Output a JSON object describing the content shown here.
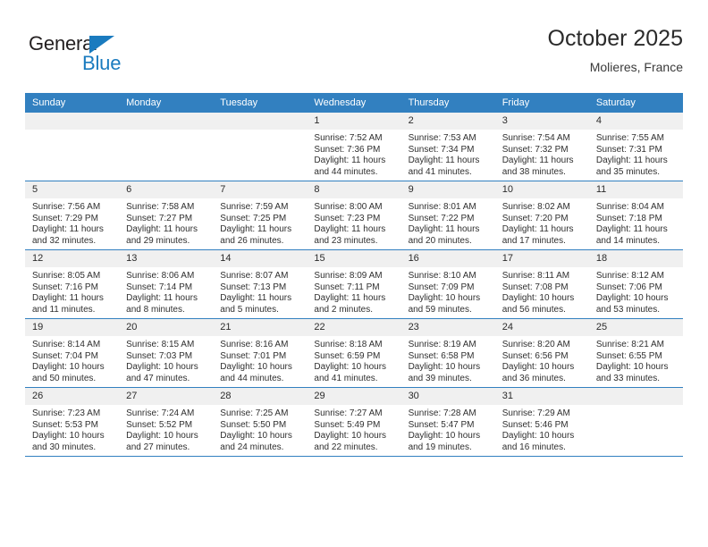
{
  "brand": {
    "name_part1": "General",
    "name_part2": "Blue",
    "triangle_icon": "triangle-icon",
    "color_primary": "#1a7bbf",
    "color_dark": "#231f20"
  },
  "header": {
    "title": "October 2025",
    "subtitle": "Molieres, France"
  },
  "theme": {
    "header_row_bg": "#3280c0",
    "daynum_bg": "#f0f0f0",
    "text": "#2f2f2f"
  },
  "weekdays": [
    "Sunday",
    "Monday",
    "Tuesday",
    "Wednesday",
    "Thursday",
    "Friday",
    "Saturday"
  ],
  "labels": {
    "sunrise": "Sunrise:",
    "sunset": "Sunset:",
    "daylight": "Daylight:"
  },
  "weeks": [
    [
      {
        "day": "",
        "sunrise": "",
        "sunset": "",
        "daylight": "",
        "empty": true
      },
      {
        "day": "",
        "sunrise": "",
        "sunset": "",
        "daylight": "",
        "empty": true
      },
      {
        "day": "",
        "sunrise": "",
        "sunset": "",
        "daylight": "",
        "empty": true
      },
      {
        "day": "1",
        "sunrise": "Sunrise: 7:52 AM",
        "sunset": "Sunset: 7:36 PM",
        "daylight": "Daylight: 11 hours and 44 minutes."
      },
      {
        "day": "2",
        "sunrise": "Sunrise: 7:53 AM",
        "sunset": "Sunset: 7:34 PM",
        "daylight": "Daylight: 11 hours and 41 minutes."
      },
      {
        "day": "3",
        "sunrise": "Sunrise: 7:54 AM",
        "sunset": "Sunset: 7:32 PM",
        "daylight": "Daylight: 11 hours and 38 minutes."
      },
      {
        "day": "4",
        "sunrise": "Sunrise: 7:55 AM",
        "sunset": "Sunset: 7:31 PM",
        "daylight": "Daylight: 11 hours and 35 minutes."
      }
    ],
    [
      {
        "day": "5",
        "sunrise": "Sunrise: 7:56 AM",
        "sunset": "Sunset: 7:29 PM",
        "daylight": "Daylight: 11 hours and 32 minutes."
      },
      {
        "day": "6",
        "sunrise": "Sunrise: 7:58 AM",
        "sunset": "Sunset: 7:27 PM",
        "daylight": "Daylight: 11 hours and 29 minutes."
      },
      {
        "day": "7",
        "sunrise": "Sunrise: 7:59 AM",
        "sunset": "Sunset: 7:25 PM",
        "daylight": "Daylight: 11 hours and 26 minutes."
      },
      {
        "day": "8",
        "sunrise": "Sunrise: 8:00 AM",
        "sunset": "Sunset: 7:23 PM",
        "daylight": "Daylight: 11 hours and 23 minutes."
      },
      {
        "day": "9",
        "sunrise": "Sunrise: 8:01 AM",
        "sunset": "Sunset: 7:22 PM",
        "daylight": "Daylight: 11 hours and 20 minutes."
      },
      {
        "day": "10",
        "sunrise": "Sunrise: 8:02 AM",
        "sunset": "Sunset: 7:20 PM",
        "daylight": "Daylight: 11 hours and 17 minutes."
      },
      {
        "day": "11",
        "sunrise": "Sunrise: 8:04 AM",
        "sunset": "Sunset: 7:18 PM",
        "daylight": "Daylight: 11 hours and 14 minutes."
      }
    ],
    [
      {
        "day": "12",
        "sunrise": "Sunrise: 8:05 AM",
        "sunset": "Sunset: 7:16 PM",
        "daylight": "Daylight: 11 hours and 11 minutes."
      },
      {
        "day": "13",
        "sunrise": "Sunrise: 8:06 AM",
        "sunset": "Sunset: 7:14 PM",
        "daylight": "Daylight: 11 hours and 8 minutes."
      },
      {
        "day": "14",
        "sunrise": "Sunrise: 8:07 AM",
        "sunset": "Sunset: 7:13 PM",
        "daylight": "Daylight: 11 hours and 5 minutes."
      },
      {
        "day": "15",
        "sunrise": "Sunrise: 8:09 AM",
        "sunset": "Sunset: 7:11 PM",
        "daylight": "Daylight: 11 hours and 2 minutes."
      },
      {
        "day": "16",
        "sunrise": "Sunrise: 8:10 AM",
        "sunset": "Sunset: 7:09 PM",
        "daylight": "Daylight: 10 hours and 59 minutes."
      },
      {
        "day": "17",
        "sunrise": "Sunrise: 8:11 AM",
        "sunset": "Sunset: 7:08 PM",
        "daylight": "Daylight: 10 hours and 56 minutes."
      },
      {
        "day": "18",
        "sunrise": "Sunrise: 8:12 AM",
        "sunset": "Sunset: 7:06 PM",
        "daylight": "Daylight: 10 hours and 53 minutes."
      }
    ],
    [
      {
        "day": "19",
        "sunrise": "Sunrise: 8:14 AM",
        "sunset": "Sunset: 7:04 PM",
        "daylight": "Daylight: 10 hours and 50 minutes."
      },
      {
        "day": "20",
        "sunrise": "Sunrise: 8:15 AM",
        "sunset": "Sunset: 7:03 PM",
        "daylight": "Daylight: 10 hours and 47 minutes."
      },
      {
        "day": "21",
        "sunrise": "Sunrise: 8:16 AM",
        "sunset": "Sunset: 7:01 PM",
        "daylight": "Daylight: 10 hours and 44 minutes."
      },
      {
        "day": "22",
        "sunrise": "Sunrise: 8:18 AM",
        "sunset": "Sunset: 6:59 PM",
        "daylight": "Daylight: 10 hours and 41 minutes."
      },
      {
        "day": "23",
        "sunrise": "Sunrise: 8:19 AM",
        "sunset": "Sunset: 6:58 PM",
        "daylight": "Daylight: 10 hours and 39 minutes."
      },
      {
        "day": "24",
        "sunrise": "Sunrise: 8:20 AM",
        "sunset": "Sunset: 6:56 PM",
        "daylight": "Daylight: 10 hours and 36 minutes."
      },
      {
        "day": "25",
        "sunrise": "Sunrise: 8:21 AM",
        "sunset": "Sunset: 6:55 PM",
        "daylight": "Daylight: 10 hours and 33 minutes."
      }
    ],
    [
      {
        "day": "26",
        "sunrise": "Sunrise: 7:23 AM",
        "sunset": "Sunset: 5:53 PM",
        "daylight": "Daylight: 10 hours and 30 minutes."
      },
      {
        "day": "27",
        "sunrise": "Sunrise: 7:24 AM",
        "sunset": "Sunset: 5:52 PM",
        "daylight": "Daylight: 10 hours and 27 minutes."
      },
      {
        "day": "28",
        "sunrise": "Sunrise: 7:25 AM",
        "sunset": "Sunset: 5:50 PM",
        "daylight": "Daylight: 10 hours and 24 minutes."
      },
      {
        "day": "29",
        "sunrise": "Sunrise: 7:27 AM",
        "sunset": "Sunset: 5:49 PM",
        "daylight": "Daylight: 10 hours and 22 minutes."
      },
      {
        "day": "30",
        "sunrise": "Sunrise: 7:28 AM",
        "sunset": "Sunset: 5:47 PM",
        "daylight": "Daylight: 10 hours and 19 minutes."
      },
      {
        "day": "31",
        "sunrise": "Sunrise: 7:29 AM",
        "sunset": "Sunset: 5:46 PM",
        "daylight": "Daylight: 10 hours and 16 minutes."
      },
      {
        "day": "",
        "sunrise": "",
        "sunset": "",
        "daylight": "",
        "empty": true
      }
    ]
  ]
}
